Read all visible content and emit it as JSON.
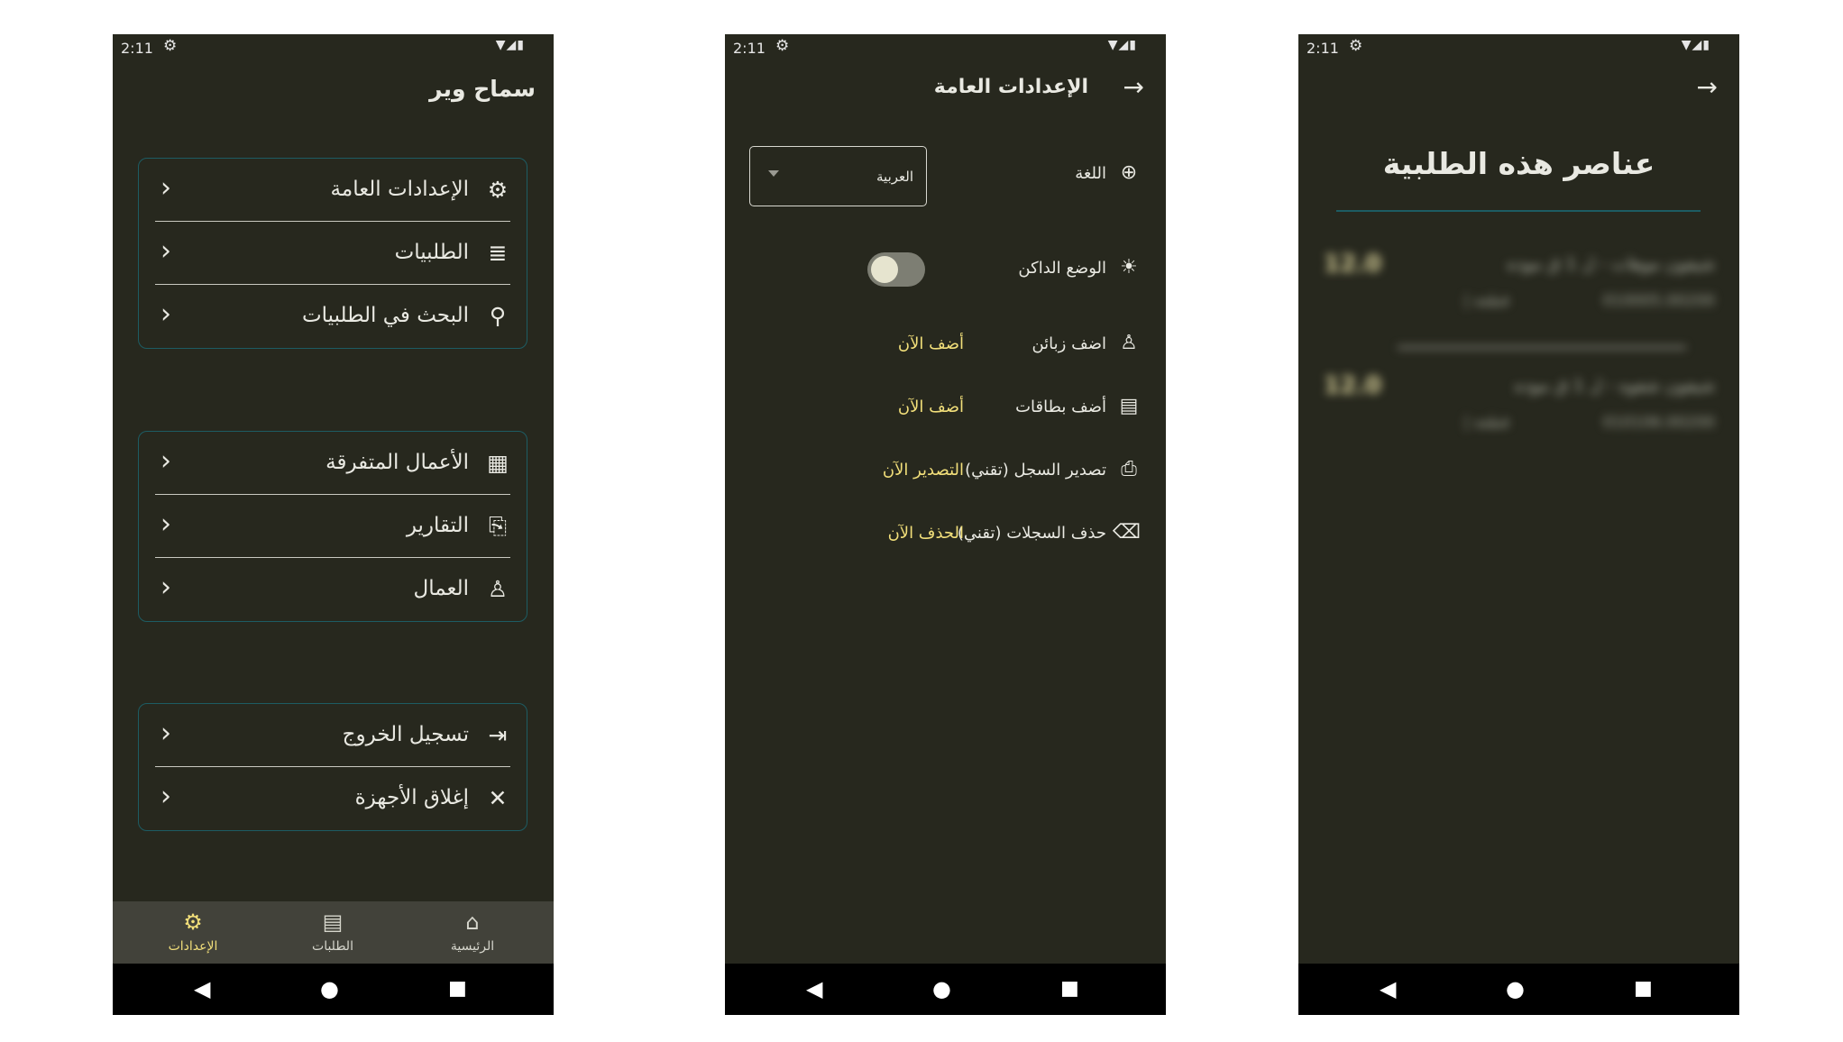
{
  "status": {
    "time": "2:11",
    "gear_icon": "gear-icon",
    "sys_icons": "▼◢▮"
  },
  "settings_menu": {
    "title": "سماح وير",
    "group1": [
      {
        "label": "الإعدادات العامة",
        "icon": "⚙"
      },
      {
        "label": "الطلبيات",
        "icon": "≣"
      },
      {
        "label": "البحث في الطلبيات",
        "icon": "⚲"
      }
    ],
    "group2": [
      {
        "label": "الأعمال المتفرقة",
        "icon": "▦"
      },
      {
        "label": "التقارير",
        "icon": "⎘"
      },
      {
        "label": "العمال",
        "icon": "♙"
      }
    ],
    "group3": [
      {
        "label": "تسجيل الخروج",
        "icon": "⇥"
      },
      {
        "label": "إغلاق الأجهزة",
        "icon": "✕"
      }
    ],
    "chevron": "‹",
    "bottom_nav": [
      {
        "label": "الإعدادات",
        "icon": "⚙",
        "active": true
      },
      {
        "label": "الطلبات",
        "icon": "▤",
        "active": false
      },
      {
        "label": "الرئيسية",
        "icon": "⌂",
        "active": false
      }
    ]
  },
  "general_settings": {
    "title": "الإعدادات العامة",
    "back_arrow": "→",
    "language": {
      "label": "اللغة",
      "icon": "⊕",
      "value": "العربية"
    },
    "dark_mode": {
      "label": "الوضع الداكن",
      "icon": "☀",
      "on": false
    },
    "rows": [
      {
        "label": "اضف زبائن",
        "icon": "♙",
        "action": "أضف الآن"
      },
      {
        "label": "أضف بطاقات",
        "icon": "▤",
        "action": "أضف الآن"
      },
      {
        "label": "تصدير السجل (تقني)",
        "icon": "⎙",
        "action": "التصدير الآن"
      },
      {
        "label": "حذف السجلات (تقني)",
        "icon": "⌫",
        "action": "الحذف الآن"
      }
    ]
  },
  "order_items": {
    "back_arrow": "→",
    "title": "عناصر هذه الطلبية",
    "items": [
      {
        "name": "شيفون موهات - ل 1 ق موده",
        "qty": "12.0",
        "code": "010005.00200",
        "unit": "قطعة |"
      },
      {
        "name": "شيفون شفوه - ل 1 ق موده",
        "qty": "12.0",
        "code": "010106.00200",
        "unit": "قطعة |"
      }
    ]
  },
  "nav": {
    "back": "◀",
    "home": "●",
    "recent": "■"
  }
}
